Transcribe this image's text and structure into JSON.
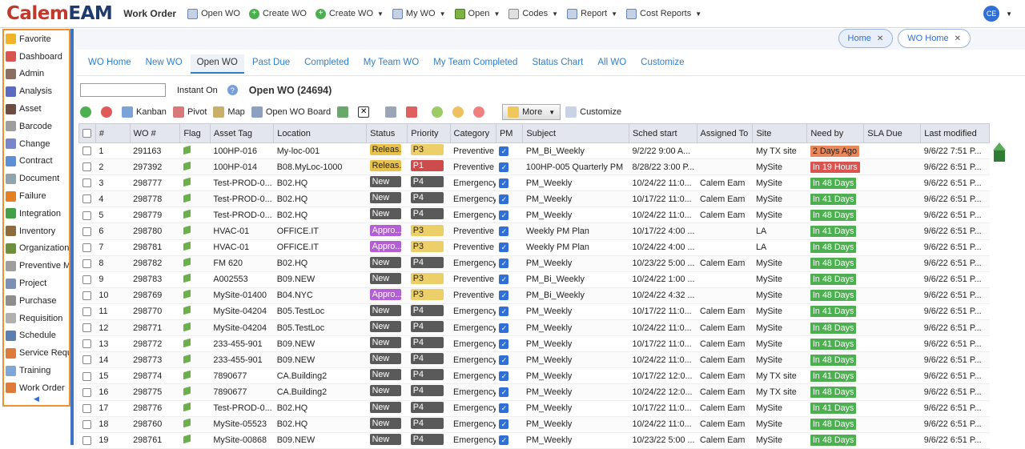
{
  "app": {
    "logo_part1": "Calem",
    "logo_part2": "EAM",
    "title": "Work Order",
    "user_initials": "CE"
  },
  "top_menu": [
    {
      "label": "Open WO",
      "icon": "document-icon",
      "has_caret": false
    },
    {
      "label": "Create WO",
      "icon": "plus-circle-icon",
      "has_caret": false
    },
    {
      "label": "Create WO",
      "icon": "plus-circle-icon",
      "has_caret": true
    },
    {
      "label": "My WO",
      "icon": "document-icon",
      "has_caret": true
    },
    {
      "label": "Open",
      "icon": "open-folder-icon",
      "has_caret": true
    },
    {
      "label": "Codes",
      "icon": "grid-icon",
      "has_caret": true
    },
    {
      "label": "Report",
      "icon": "report-icon",
      "has_caret": true
    },
    {
      "label": "Cost Reports",
      "icon": "cost-report-icon",
      "has_caret": true
    }
  ],
  "sidebar": {
    "items": [
      {
        "label": "Favorite",
        "icon": "star-icon",
        "color": "#f0b429"
      },
      {
        "label": "Dashboard",
        "icon": "chart-icon",
        "color": "#d9534f"
      },
      {
        "label": "Admin",
        "icon": "admin-icon",
        "color": "#8d6e63"
      },
      {
        "label": "Analysis",
        "icon": "bar-chart-icon",
        "color": "#5c6bc0"
      },
      {
        "label": "Asset",
        "icon": "asset-icon",
        "color": "#6d4c41"
      },
      {
        "label": "Barcode",
        "icon": "barcode-icon",
        "color": "#9e9e9e"
      },
      {
        "label": "Change",
        "icon": "change-icon",
        "color": "#7986cb"
      },
      {
        "label": "Contract",
        "icon": "contract-icon",
        "color": "#5c8fd6"
      },
      {
        "label": "Document",
        "icon": "document-icon",
        "color": "#90a4ae"
      },
      {
        "label": "Failure",
        "icon": "failure-icon",
        "color": "#e67e22"
      },
      {
        "label": "Integration",
        "icon": "puzzle-icon",
        "color": "#43a047"
      },
      {
        "label": "Inventory",
        "icon": "inventory-icon",
        "color": "#8e6b3e"
      },
      {
        "label": "Organization",
        "icon": "organization-icon",
        "color": "#6d8f3e"
      },
      {
        "label": "Preventive Ma",
        "icon": "preventive-icon",
        "color": "#9e9e9e"
      },
      {
        "label": "Project",
        "icon": "project-icon",
        "color": "#7c8fb5"
      },
      {
        "label": "Purchase",
        "icon": "purchase-icon",
        "color": "#8e8e8e"
      },
      {
        "label": "Requisition",
        "icon": "requisition-icon",
        "color": "#b0b0b0"
      },
      {
        "label": "Schedule",
        "icon": "schedule-icon",
        "color": "#5a7fb0"
      },
      {
        "label": "Service Reque",
        "icon": "service-request-icon",
        "color": "#e07a3a"
      },
      {
        "label": "Training",
        "icon": "training-icon",
        "color": "#7ea6d6"
      },
      {
        "label": "Work Order",
        "icon": "work-order-icon",
        "color": "#e07a3a"
      }
    ],
    "collapse_glyph": "◀"
  },
  "page_tabs": [
    {
      "label": "Home",
      "active": false
    },
    {
      "label": "WO Home",
      "active": true
    }
  ],
  "sub_tabs": [
    {
      "label": "WO Home",
      "active": false
    },
    {
      "label": "New WO",
      "active": false
    },
    {
      "label": "Open WO",
      "active": true
    },
    {
      "label": "Past Due",
      "active": false
    },
    {
      "label": "Completed",
      "active": false
    },
    {
      "label": "My Team WO",
      "active": false
    },
    {
      "label": "My Team Completed",
      "active": false
    },
    {
      "label": "Status Chart",
      "active": false
    },
    {
      "label": "All WO",
      "active": false
    },
    {
      "label": "Customize",
      "active": false
    }
  ],
  "search": {
    "value": "",
    "instant_label": "Instant On"
  },
  "view_title": "Open WO (24694)",
  "toolbar": {
    "kanban": "Kanban",
    "pivot": "Pivot",
    "map": "Map",
    "board": "Open WO Board",
    "more": "More",
    "customize": "Customize"
  },
  "table": {
    "headers": [
      "#",
      "WO #",
      "Flag",
      "Asset Tag",
      "Location",
      "Status",
      "Priority",
      "Category",
      "PM",
      "Subject",
      "Sched start",
      "Assigned To",
      "Site",
      "Need by",
      "SLA Due",
      "Last modified"
    ],
    "rows": [
      [
        "1",
        "291163",
        "100HP-016",
        "My-loc-001",
        "Releas...",
        "P3",
        "Preventive",
        "PM_Bi_Weekly",
        "9/2/22 9:00 A...",
        "",
        "My TX site",
        "2 Days Ago",
        "",
        "9/6/22 7:51 P..."
      ],
      [
        "2",
        "297392",
        "100HP-014",
        "B08.MyLoc-1000",
        "Releas...",
        "P1",
        "Preventive",
        "100HP-005 Quarterly PM",
        "8/28/22 3:00 P...",
        "",
        "MySite",
        "In 19 Hours",
        "",
        "9/6/22 6:51 P..."
      ],
      [
        "3",
        "298777",
        "Test-PROD-0...",
        "B02.HQ",
        "New",
        "P4",
        "Emergency",
        "PM_Weekly",
        "10/24/22 11:0...",
        "Calem Eam",
        "MySite",
        "In 48 Days",
        "",
        "9/6/22 6:51 P..."
      ],
      [
        "4",
        "298778",
        "Test-PROD-0...",
        "B02.HQ",
        "New",
        "P4",
        "Emergency",
        "PM_Weekly",
        "10/17/22 11:0...",
        "Calem Eam",
        "MySite",
        "In 41 Days",
        "",
        "9/6/22 6:51 P..."
      ],
      [
        "5",
        "298779",
        "Test-PROD-0...",
        "B02.HQ",
        "New",
        "P4",
        "Emergency",
        "PM_Weekly",
        "10/24/22 11:0...",
        "Calem Eam",
        "MySite",
        "In 48 Days",
        "",
        "9/6/22 6:51 P..."
      ],
      [
        "6",
        "298780",
        "HVAC-01",
        "OFFICE.IT",
        "Appro...",
        "P3",
        "Preventive",
        "Weekly PM Plan",
        "10/17/22 4:00 ...",
        "",
        "LA",
        "In 41 Days",
        "",
        "9/6/22 6:51 P..."
      ],
      [
        "7",
        "298781",
        "HVAC-01",
        "OFFICE.IT",
        "Appro...",
        "P3",
        "Preventive",
        "Weekly PM Plan",
        "10/24/22 4:00 ...",
        "",
        "LA",
        "In 48 Days",
        "",
        "9/6/22 6:51 P..."
      ],
      [
        "8",
        "298782",
        "FM 620",
        "B02.HQ",
        "New",
        "P4",
        "Emergency",
        "PM_Weekly",
        "10/23/22 5:00 ...",
        "Calem Eam",
        "MySite",
        "In 48 Days",
        "",
        "9/6/22 6:51 P..."
      ],
      [
        "9",
        "298783",
        "A002553",
        "B09.NEW",
        "New",
        "P3",
        "Preventive",
        "PM_Bi_Weekly",
        "10/24/22 1:00 ...",
        "",
        "MySite",
        "In 48 Days",
        "",
        "9/6/22 6:51 P..."
      ],
      [
        "10",
        "298769",
        "MySite-01400",
        "B04.NYC",
        "Appro...",
        "P3",
        "Preventive",
        "PM_Bi_Weekly",
        "10/24/22 4:32 ...",
        "",
        "MySite",
        "In 48 Days",
        "",
        "9/6/22 6:51 P..."
      ],
      [
        "11",
        "298770",
        "MySite-04204",
        "B05.TestLoc",
        "New",
        "P4",
        "Emergency",
        "PM_Weekly",
        "10/17/22 11:0...",
        "Calem Eam",
        "MySite",
        "In 41 Days",
        "",
        "9/6/22 6:51 P..."
      ],
      [
        "12",
        "298771",
        "MySite-04204",
        "B05.TestLoc",
        "New",
        "P4",
        "Emergency",
        "PM_Weekly",
        "10/24/22 11:0...",
        "Calem Eam",
        "MySite",
        "In 48 Days",
        "",
        "9/6/22 6:51 P..."
      ],
      [
        "13",
        "298772",
        "233-455-901",
        "B09.NEW",
        "New",
        "P4",
        "Emergency",
        "PM_Weekly",
        "10/17/22 11:0...",
        "Calem Eam",
        "MySite",
        "In 41 Days",
        "",
        "9/6/22 6:51 P..."
      ],
      [
        "14",
        "298773",
        "233-455-901",
        "B09.NEW",
        "New",
        "P4",
        "Emergency",
        "PM_Weekly",
        "10/24/22 11:0...",
        "Calem Eam",
        "MySite",
        "In 48 Days",
        "",
        "9/6/22 6:51 P..."
      ],
      [
        "15",
        "298774",
        "7890677",
        "CA.Building2",
        "New",
        "P4",
        "Emergency",
        "PM_Weekly",
        "10/17/22 12:0...",
        "Calem Eam",
        "My TX site",
        "In 41 Days",
        "",
        "9/6/22 6:51 P..."
      ],
      [
        "16",
        "298775",
        "7890677",
        "CA.Building2",
        "New",
        "P4",
        "Emergency",
        "PM_Weekly",
        "10/24/22 12:0...",
        "Calem Eam",
        "My TX site",
        "In 48 Days",
        "",
        "9/6/22 6:51 P..."
      ],
      [
        "17",
        "298776",
        "Test-PROD-0...",
        "B02.HQ",
        "New",
        "P4",
        "Emergency",
        "PM_Weekly",
        "10/17/22 11:0...",
        "Calem Eam",
        "MySite",
        "In 41 Days",
        "",
        "9/6/22 6:51 P..."
      ],
      [
        "18",
        "298760",
        "MySite-05523",
        "B02.HQ",
        "New",
        "P4",
        "Emergency",
        "PM_Weekly",
        "10/24/22 11:0...",
        "Calem Eam",
        "MySite",
        "In 48 Days",
        "",
        "9/6/22 6:51 P..."
      ],
      [
        "19",
        "298761",
        "MySite-00868",
        "B09.NEW",
        "New",
        "P4",
        "Emergency",
        "PM_Weekly",
        "10/23/22 5:00 ...",
        "Calem Eam",
        "MySite",
        "In 48 Days",
        "",
        "9/6/22 6:51 P..."
      ]
    ]
  },
  "colors": {
    "accent": "#2f6fd6",
    "sidebar_border": "#f09030",
    "status_new": "#5a5a5a",
    "status_released": "#e8c24a",
    "status_approved": "#b45ed4",
    "need_green": "#4caf50",
    "need_red": "#d9534f",
    "need_orange": "#e8885a"
  }
}
